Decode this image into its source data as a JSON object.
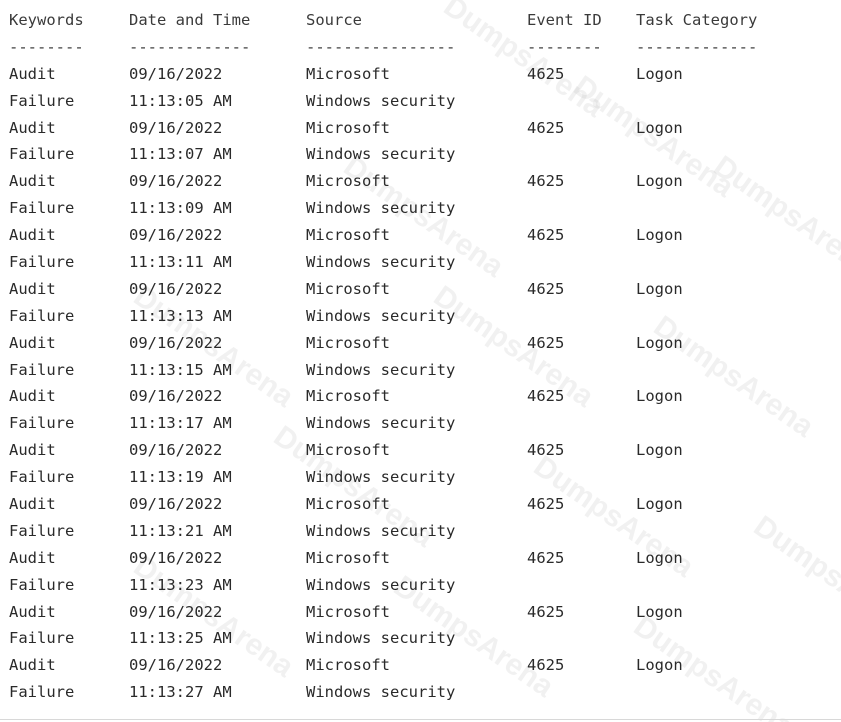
{
  "columns": {
    "keywords": "Keywords",
    "date_time": "Date and Time",
    "source": "Source",
    "event_id": "Event ID",
    "task_category": "Task Category"
  },
  "separators": {
    "keywords": "--------",
    "date_time": "-------------",
    "source": "----------------",
    "event_id": "--------",
    "task_category": "-------------"
  },
  "events": [
    {
      "kw1": "Audit",
      "kw2": "Failure",
      "date": "09/16/2022",
      "time": "11:13:05 AM",
      "src1": "Microsoft",
      "src2": "Windows security",
      "event_id": "4625",
      "task": "Logon"
    },
    {
      "kw1": "Audit",
      "kw2": "Failure",
      "date": "09/16/2022",
      "time": "11:13:07 AM",
      "src1": "Microsoft",
      "src2": "Windows security",
      "event_id": "4625",
      "task": "Logon"
    },
    {
      "kw1": "Audit",
      "kw2": "Failure",
      "date": "09/16/2022",
      "time": "11:13:09 AM",
      "src1": "Microsoft",
      "src2": "Windows security",
      "event_id": "4625",
      "task": "Logon"
    },
    {
      "kw1": "Audit",
      "kw2": "Failure",
      "date": "09/16/2022",
      "time": "11:13:11 AM",
      "src1": "Microsoft",
      "src2": "Windows security",
      "event_id": "4625",
      "task": "Logon"
    },
    {
      "kw1": "Audit",
      "kw2": "Failure",
      "date": "09/16/2022",
      "time": "11:13:13 AM",
      "src1": "Microsoft",
      "src2": "Windows security",
      "event_id": "4625",
      "task": "Logon"
    },
    {
      "kw1": "Audit",
      "kw2": "Failure",
      "date": "09/16/2022",
      "time": "11:13:15 AM",
      "src1": "Microsoft",
      "src2": "Windows security",
      "event_id": "4625",
      "task": "Logon"
    },
    {
      "kw1": "Audit",
      "kw2": "Failure",
      "date": "09/16/2022",
      "time": "11:13:17 AM",
      "src1": "Microsoft",
      "src2": "Windows security",
      "event_id": "4625",
      "task": "Logon"
    },
    {
      "kw1": "Audit",
      "kw2": "Failure",
      "date": "09/16/2022",
      "time": "11:13:19 AM",
      "src1": "Microsoft",
      "src2": "Windows security",
      "event_id": "4625",
      "task": "Logon"
    },
    {
      "kw1": "Audit",
      "kw2": "Failure",
      "date": "09/16/2022",
      "time": "11:13:21 AM",
      "src1": "Microsoft",
      "src2": "Windows security",
      "event_id": "4625",
      "task": "Logon"
    },
    {
      "kw1": "Audit",
      "kw2": "Failure",
      "date": "09/16/2022",
      "time": "11:13:23 AM",
      "src1": "Microsoft",
      "src2": "Windows security",
      "event_id": "4625",
      "task": "Logon"
    },
    {
      "kw1": "Audit",
      "kw2": "Failure",
      "date": "09/16/2022",
      "time": "11:13:25 AM",
      "src1": "Microsoft",
      "src2": "Windows security",
      "event_id": "4625",
      "task": "Logon"
    },
    {
      "kw1": "Audit",
      "kw2": "Failure",
      "date": "09/16/2022",
      "time": "11:13:27 AM",
      "src1": "Microsoft",
      "src2": "Windows security",
      "event_id": "4625",
      "task": "Logon"
    }
  ],
  "watermark_text": "DumpsArena",
  "colors": {
    "text": "#2a2a2a",
    "background": "#ffffff"
  }
}
